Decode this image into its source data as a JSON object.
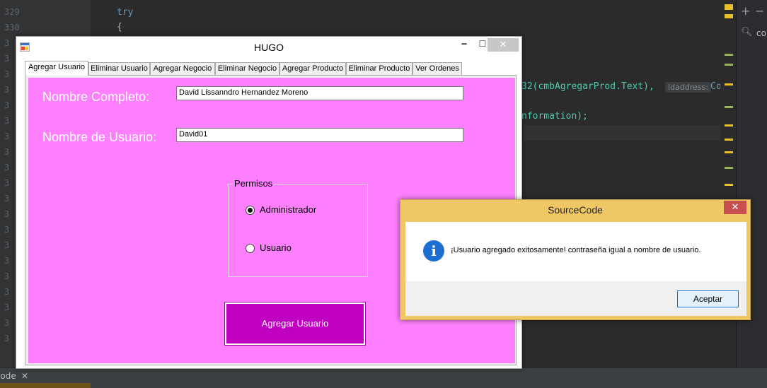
{
  "ide": {
    "line_numbers": [
      "329",
      "330",
      "3",
      "3",
      "3",
      "3",
      "3",
      "3",
      "3",
      "3",
      "3",
      "3",
      "3",
      "3",
      "3",
      "3",
      "3",
      "3",
      "3",
      "3",
      "3",
      "3"
    ],
    "code_try": "try",
    "code_brace": "{",
    "code_call_suffix": "32(cmbAgregarProd.Text),",
    "code_hint": "idaddress:",
    "code_hint_after": "Conv",
    "code_information": "nformation);",
    "status_tab": "Code",
    "status_tab_close": "✕",
    "search_text": "co",
    "marker_colors": [
      "#e6c229",
      "#e6c229",
      "#9ab45a",
      "#9ab45a",
      "#e6c229"
    ]
  },
  "form": {
    "title": "HUGO",
    "minimize_glyph": "🗕",
    "maximize_glyph": "☐",
    "close_glyph": "✕",
    "tabs": [
      {
        "label": "Agregar Usuario"
      },
      {
        "label": "Eliminar Usuario"
      },
      {
        "label": "Agregar Negocio"
      },
      {
        "label": "Eliminar Negocio"
      },
      {
        "label": "Agregar Producto"
      },
      {
        "label": "Eliminar Producto"
      },
      {
        "label": "Ver Ordenes"
      }
    ],
    "full_name_label": "Nombre Completo:",
    "full_name_value": "David Lissanndro Hernandez Moreno",
    "username_label": "Nombre de Usuario:",
    "username_value": "David01",
    "permissions_group": "Permisos",
    "radio_admin": "Administrador",
    "radio_user": "Usuario",
    "submit_label": "Agregar Usuario",
    "page_color": "#ff80ff",
    "button_color": "#c000c0"
  },
  "messagebox": {
    "title": "SourceCode",
    "close_glyph": "✕",
    "icon_glyph": "i",
    "message": "¡Usuario agregado exitosamente! contraseña igual a nombre de usuario.",
    "ok_label": "Aceptar"
  }
}
